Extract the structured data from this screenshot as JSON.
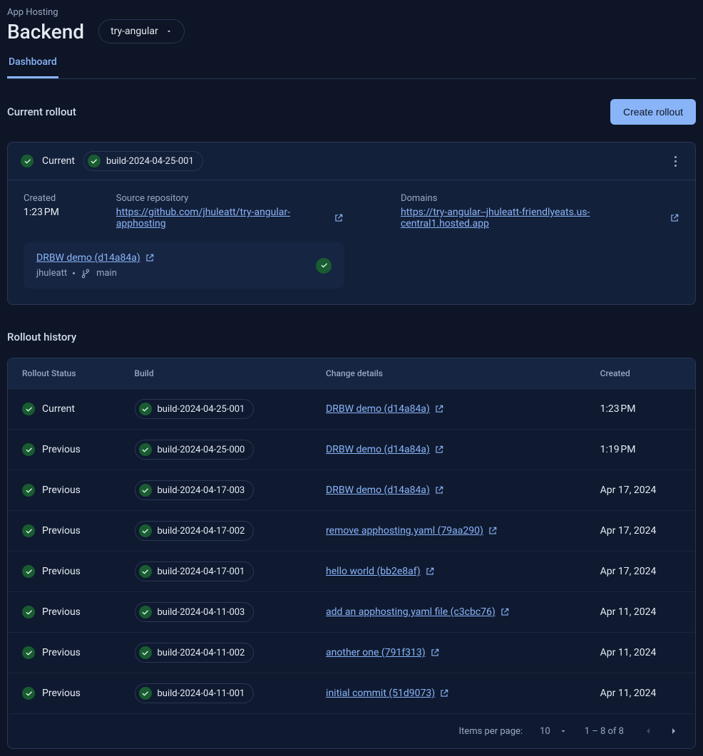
{
  "header": {
    "breadcrumb": "App Hosting",
    "title": "Backend",
    "project_select": "try-angular"
  },
  "tabs": [
    {
      "label": "Dashboard",
      "active": true
    }
  ],
  "current_rollout": {
    "heading": "Current rollout",
    "create_button": "Create rollout",
    "status_label": "Current",
    "build_id": "build-2024-04-25-001",
    "created_label": "Created",
    "created_value": "1:23 PM",
    "repo_label": "Source repository",
    "repo_url": "https://github.com/jhuleatt/try-angular-apphosting",
    "domains_label": "Domains",
    "domain_url": "https://try-angular--jhuleatt-friendlyeats.us-central1.hosted.app",
    "commit": {
      "title": "DRBW demo (d14a84a)",
      "user": "jhuleatt",
      "branch": "main"
    }
  },
  "history": {
    "heading": "Rollout history",
    "columns": {
      "status": "Rollout Status",
      "build": "Build",
      "change": "Change details",
      "created": "Created"
    },
    "rows": [
      {
        "status": "Current",
        "build": "build-2024-04-25-001",
        "change": "DRBW demo (d14a84a)",
        "created": "1:23 PM"
      },
      {
        "status": "Previous",
        "build": "build-2024-04-25-000",
        "change": "DRBW demo (d14a84a)",
        "created": "1:19 PM"
      },
      {
        "status": "Previous",
        "build": "build-2024-04-17-003",
        "change": "DRBW demo (d14a84a)",
        "created": "Apr 17, 2024"
      },
      {
        "status": "Previous",
        "build": "build-2024-04-17-002",
        "change": "remove apphosting.yaml (79aa290)",
        "created": "Apr 17, 2024"
      },
      {
        "status": "Previous",
        "build": "build-2024-04-17-001",
        "change": "hello world (bb2e8af)",
        "created": "Apr 17, 2024"
      },
      {
        "status": "Previous",
        "build": "build-2024-04-11-003",
        "change": "add an apphosting.yaml file (c3cbc76)",
        "created": "Apr 11, 2024"
      },
      {
        "status": "Previous",
        "build": "build-2024-04-11-002",
        "change": "another one (791f313)",
        "created": "Apr 11, 2024"
      },
      {
        "status": "Previous",
        "build": "build-2024-04-11-001",
        "change": "initial commit (51d9073)",
        "created": "Apr 11, 2024"
      }
    ],
    "pager": {
      "items_label": "Items per page:",
      "page_size": "10",
      "range": "1 – 8 of 8"
    }
  }
}
